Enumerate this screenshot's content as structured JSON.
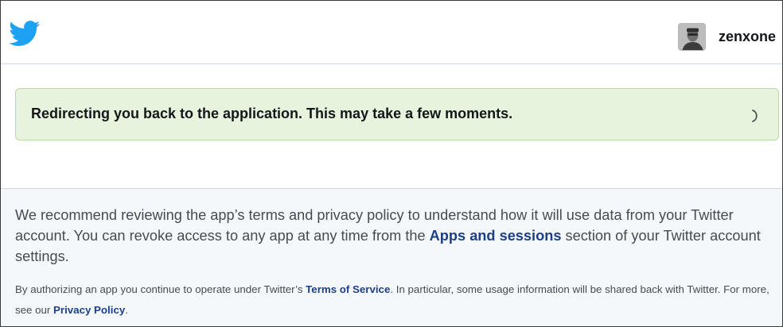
{
  "header": {
    "logo_icon": "twitter-bird-icon",
    "username": "zenxone",
    "brand_color": "#1da1f2"
  },
  "alert": {
    "message": "Redirecting you back to the application. This may take a few moments.",
    "spinner_icon": "loading-spinner-icon",
    "background_color": "#e7f3dc"
  },
  "info": {
    "paragraph1": {
      "part1": "We recommend reviewing the app’s terms and privacy policy to understand how it will use data from your Twitter account. You can revoke access to any app at any time from the ",
      "link_label": "Apps and sessions",
      "part2": " section of your Twitter account settings."
    },
    "paragraph2": {
      "part1": "By authorizing an app you continue to operate under Twitter’s ",
      "terms_link": "Terms of Service",
      "part2": ". In particular, some usage information will be shared back with Twitter. For more, see our ",
      "privacy_link": "Privacy Policy",
      "part3": "."
    },
    "link_color": "#1c3f87"
  }
}
